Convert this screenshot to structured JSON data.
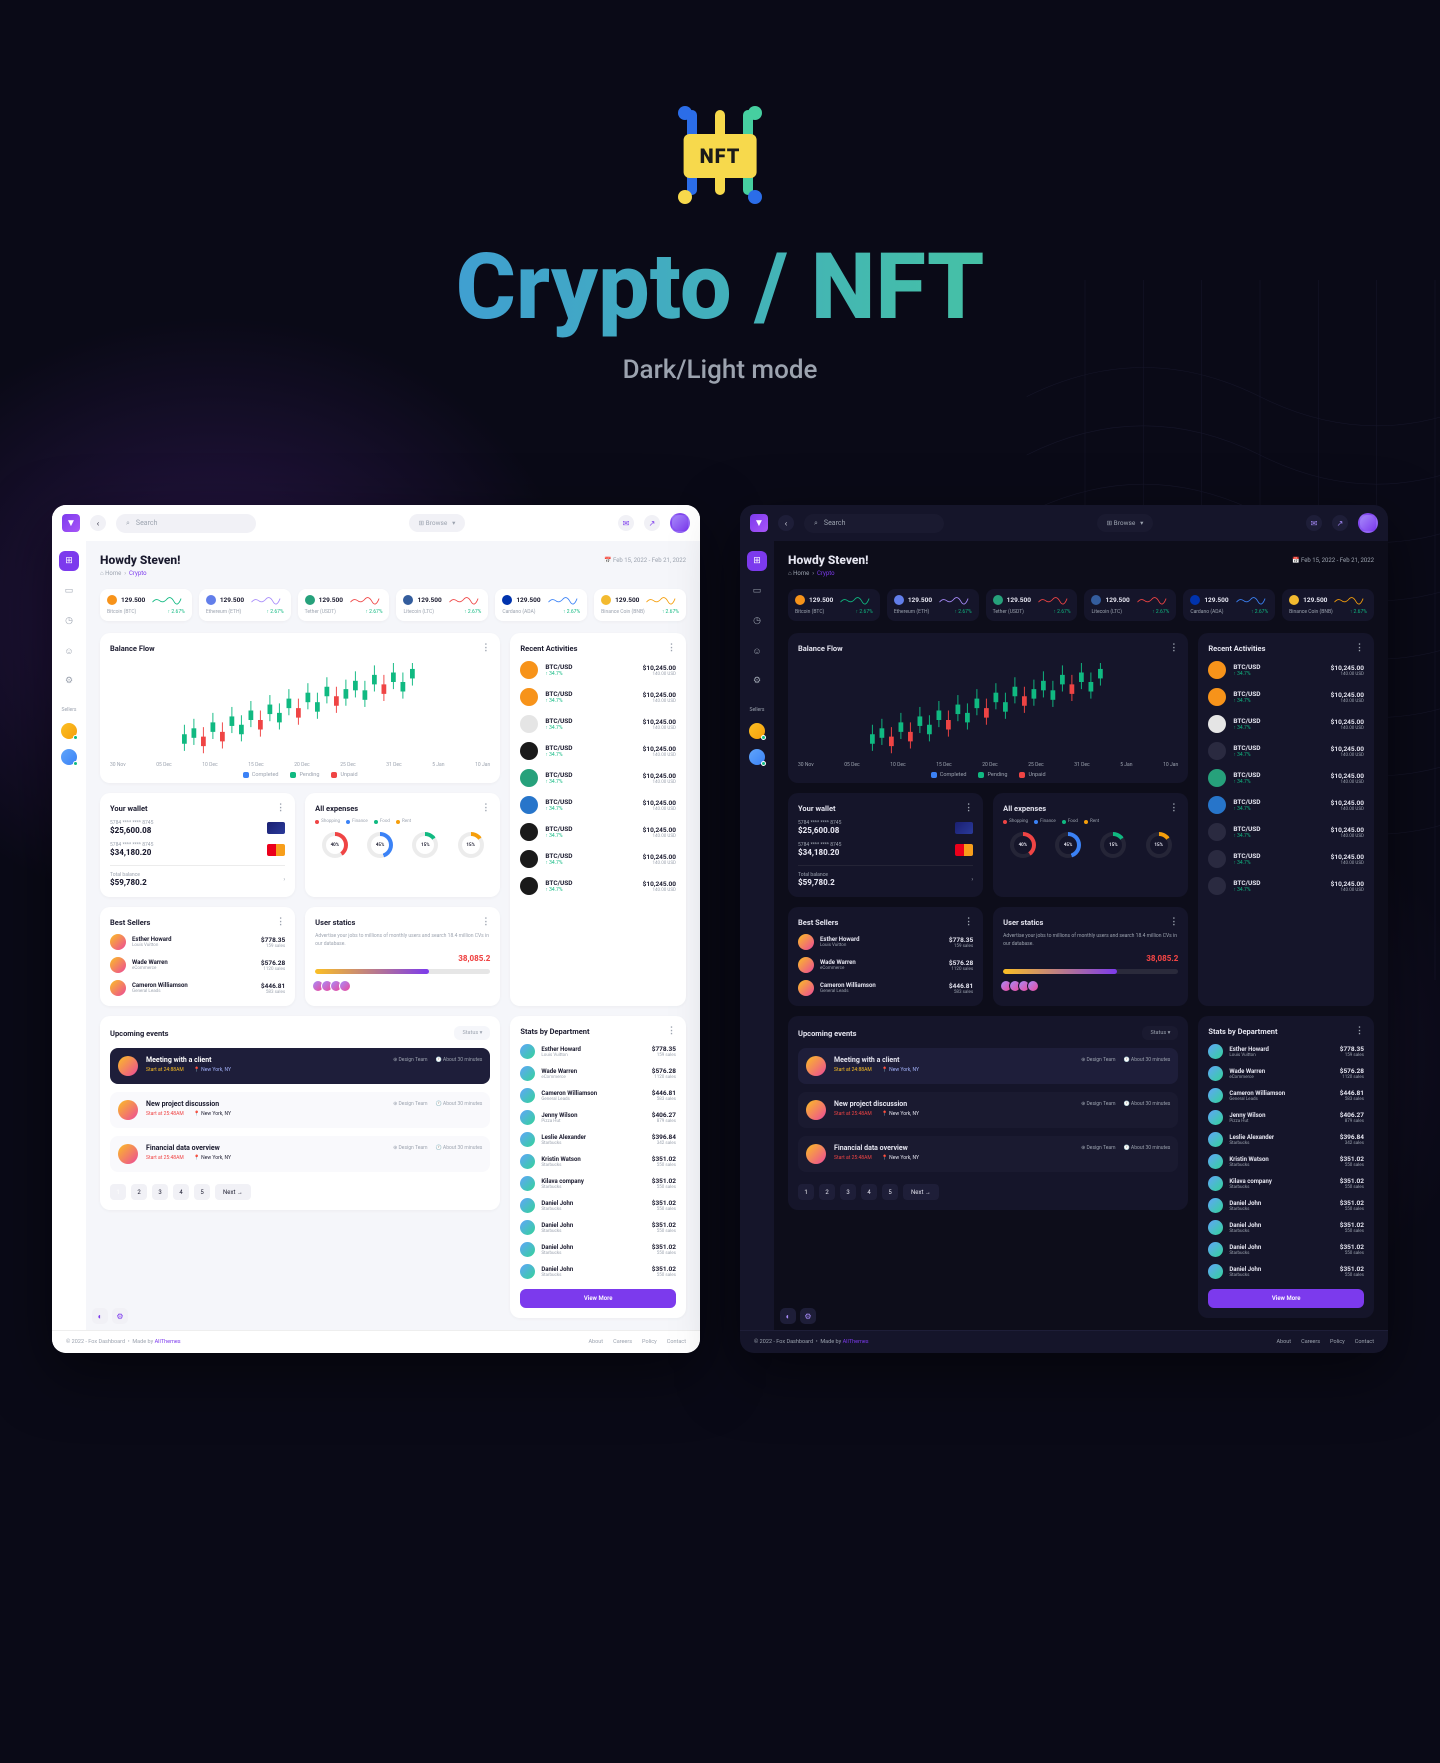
{
  "hero": {
    "title": "Crypto / NFT",
    "subtitle": "Dark/Light mode",
    "badge": "NFT"
  },
  "header": {
    "search_placeholder": "Search",
    "browse": "Browse"
  },
  "greeting": {
    "text": "Howdy Steven!",
    "date": "Feb 15, 2022 - Feb 21, 2022"
  },
  "breadcrumbs": {
    "home": "Home",
    "current": "Crypto"
  },
  "sidebar": {
    "sellers_label": "Sellers"
  },
  "tickers": [
    {
      "coin": "Bitcoin (BTC)",
      "value": "129.500",
      "change": "2.67%",
      "color": "#f7931a",
      "spark": "#10b981"
    },
    {
      "coin": "Ethereum (ETH)",
      "value": "129.500",
      "change": "2.67%",
      "color": "#627eea",
      "spark": "#a78bfa"
    },
    {
      "coin": "Tether (USDT)",
      "value": "129.500",
      "change": "2.67%",
      "color": "#26a17b",
      "spark": "#ef4444"
    },
    {
      "coin": "Litecoin (LTC)",
      "value": "129.500",
      "change": "2.67%",
      "color": "#345d9d",
      "spark": "#ef4444"
    },
    {
      "coin": "Cardano (ADA)",
      "value": "129.500",
      "change": "2.67%",
      "color": "#0033ad",
      "spark": "#3b82f6"
    },
    {
      "coin": "Binance Coin (BNB)",
      "value": "129.500",
      "change": "2.67%",
      "color": "#f3ba2f",
      "spark": "#f59e0b"
    }
  ],
  "balance_flow": {
    "title": "Balance Flow",
    "legend": [
      {
        "label": "Completed",
        "color": "#3b82f6"
      },
      {
        "label": "Pending",
        "color": "#10b981"
      },
      {
        "label": "Unpaid",
        "color": "#ef4444"
      }
    ],
    "xaxis": [
      "30 Nov",
      "05 Dec",
      "10 Dec",
      "15 Dec",
      "20 Dec",
      "25 Dec",
      "31 Dec",
      "5 Jan",
      "10 Jan"
    ]
  },
  "activities": {
    "title": "Recent Activities",
    "items": [
      {
        "pair": "BTC/USD",
        "change": "34.7%",
        "amount": "$10,245.00",
        "sub": "140.00 USD",
        "color": "#f7931a"
      },
      {
        "pair": "BTC/USD",
        "change": "34.7%",
        "amount": "$10,245.00",
        "sub": "140.00 USD",
        "color": "#f7931a"
      },
      {
        "pair": "BTC/USD",
        "change": "34.7%",
        "amount": "$10,245.00",
        "sub": "140.00 USD",
        "color": "#e5e5e5"
      },
      {
        "pair": "BTC/USD",
        "change": "34.7%",
        "amount": "$10,245.00",
        "sub": "140.00 USD",
        "color": "#1a1a1a"
      },
      {
        "pair": "BTC/USD",
        "change": "34.7%",
        "amount": "$10,245.00",
        "sub": "140.00 USD",
        "color": "#26a17b"
      },
      {
        "pair": "BTC/USD",
        "change": "34.7%",
        "amount": "$10,245.00",
        "sub": "140.00 USD",
        "color": "#2775ca"
      },
      {
        "pair": "BTC/USD",
        "change": "34.7%",
        "amount": "$10,245.00",
        "sub": "140.00 USD",
        "color": "#1a1a1a"
      },
      {
        "pair": "BTC/USD",
        "change": "34.7%",
        "amount": "$10,245.00",
        "sub": "140.00 USD",
        "color": "#1a1a1a"
      },
      {
        "pair": "BTC/USD",
        "change": "34.7%",
        "amount": "$10,245.00",
        "sub": "140.00 USD",
        "color": "#1a1a1a"
      }
    ]
  },
  "wallet": {
    "title": "Your wallet",
    "card1_label": "5784 **** **** 8745",
    "card1_amount": "$25,600.08",
    "card2_label": "5784 **** **** 8745",
    "card2_amount": "$34,180.20",
    "total_label": "Total balance",
    "total": "$59,780.2"
  },
  "expenses": {
    "title": "All expenses",
    "legend": [
      {
        "label": "Shopping",
        "color": "#ef4444"
      },
      {
        "label": "Finance",
        "color": "#3b82f6"
      },
      {
        "label": "Food",
        "color": "#10b981"
      },
      {
        "label": "Rent",
        "color": "#f59e0b"
      }
    ],
    "donuts": [
      "40%",
      "45%",
      "15%",
      "15%"
    ]
  },
  "best_sellers": {
    "title": "Best Sellers",
    "items": [
      {
        "name": "Esther Howard",
        "company": "Louis Vuitton",
        "amount": "$778.35",
        "sales": "159 sales"
      },
      {
        "name": "Wade Warren",
        "company": "eCommerce",
        "amount": "$576.28",
        "sales": "1120 sales"
      },
      {
        "name": "Cameron Williamson",
        "company": "General Leads",
        "amount": "$446.81",
        "sales": "583 sales"
      }
    ]
  },
  "user_statics": {
    "title": "User statics",
    "desc": "Advertise your jobs to millions of monthly users and search 18.4 million CVs in our database.",
    "number": "38,085.2"
  },
  "dept": {
    "title": "Stats by Department",
    "items": [
      {
        "name": "Esther Howard",
        "company": "Louis Vuitton",
        "amount": "$778.35",
        "sales": "159 sales"
      },
      {
        "name": "Wade Warren",
        "company": "eCommerce",
        "amount": "$576.28",
        "sales": "1120 sales"
      },
      {
        "name": "Cameron Williamson",
        "company": "General Leads",
        "amount": "$446.81",
        "sales": "583 sales"
      },
      {
        "name": "Jenny Wilson",
        "company": "Pizza Hut",
        "amount": "$406.27",
        "sales": "879 sales"
      },
      {
        "name": "Leslie Alexander",
        "company": "Starbucks",
        "amount": "$396.84",
        "sales": "342 sales"
      },
      {
        "name": "Kristin Watson",
        "company": "Starbucks",
        "amount": "$351.02",
        "sales": "550 sales"
      },
      {
        "name": "Kilava company",
        "company": "Starbucks",
        "amount": "$351.02",
        "sales": "550 sales"
      },
      {
        "name": "Daniel John",
        "company": "Starbucks",
        "amount": "$351.02",
        "sales": "550 sales"
      },
      {
        "name": "Daniel John",
        "company": "Starbucks",
        "amount": "$351.02",
        "sales": "550 sales"
      },
      {
        "name": "Daniel John",
        "company": "Starbucks",
        "amount": "$351.02",
        "sales": "550 sales"
      },
      {
        "name": "Daniel John",
        "company": "Starbucks",
        "amount": "$351.02",
        "sales": "550 sales"
      }
    ],
    "view_more": "View More"
  },
  "events": {
    "title": "Upcoming events",
    "filter": "Status",
    "items": [
      {
        "title": "Meeting with a client",
        "time": "Start at 24:88AM",
        "loc": "New York, NY",
        "tag1": "Design Team",
        "tag2": "About 30 minutes",
        "active": true
      },
      {
        "title": "New project discussion",
        "time": "Start at 25:48AM",
        "loc": "New York, NY",
        "tag1": "Design Team",
        "tag2": "About 30 minutes",
        "active": false
      },
      {
        "title": "Financial data overview",
        "time": "Start at 25:48AM",
        "loc": "New York, NY",
        "tag1": "Design Team",
        "tag2": "About 30 minutes",
        "active": false
      }
    ]
  },
  "pagination": {
    "pages": [
      "1",
      "2",
      "3",
      "4",
      "5"
    ],
    "next": "Next"
  },
  "footer": {
    "copyright": "© 2022 - Fox Dashboard",
    "made": "Made by",
    "author": "AllThemes",
    "links": [
      "About",
      "Careers",
      "Policy",
      "Contact"
    ]
  }
}
